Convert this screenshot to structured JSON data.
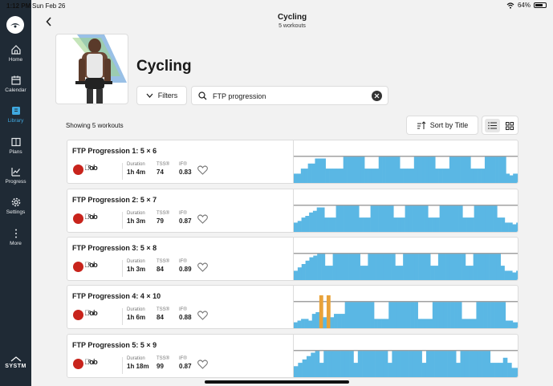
{
  "status": {
    "time": "1:12 PM",
    "date": "Sun Feb 26",
    "battery": "64%"
  },
  "nav": {
    "items": [
      {
        "label": "Home",
        "icon": "home-icon",
        "active": false
      },
      {
        "label": "Calendar",
        "icon": "calendar-icon",
        "active": false
      },
      {
        "label": "Library",
        "icon": "library-icon",
        "active": true
      },
      {
        "label": "Plans",
        "icon": "plans-icon",
        "active": false
      },
      {
        "label": "Progress",
        "icon": "progress-icon",
        "active": false
      },
      {
        "label": "Settings",
        "icon": "gear-icon",
        "active": false
      },
      {
        "label": "More",
        "icon": "more-icon",
        "active": false
      }
    ],
    "brand": "SYSTM"
  },
  "header": {
    "title": "Cycling",
    "subtitle": "5 workouts"
  },
  "page": {
    "title": "Cycling",
    "filters_label": "Filters",
    "search_value": "FTP progression",
    "showing": "Showing 5 workouts",
    "sort_label": "Sort by Title"
  },
  "workouts": [
    {
      "title": "FTP Progression 1: 5 × 6",
      "duration_label": "Duration",
      "duration": "1h 4m",
      "tss_label": "TSS®",
      "tss": "74",
      "if_label": "IF®",
      "if": "0.83",
      "profile": [
        0.3,
        0.3,
        0.45,
        0.45,
        0.6,
        0.6,
        0.75,
        0.75,
        0.75,
        0.45,
        0.45,
        0.45,
        0.45,
        0.45,
        0.8,
        0.8,
        0.8,
        0.8,
        0.8,
        0.8,
        0.45,
        0.45,
        0.45,
        0.45,
        0.8,
        0.8,
        0.8,
        0.8,
        0.8,
        0.8,
        0.45,
        0.45,
        0.45,
        0.45,
        0.8,
        0.8,
        0.8,
        0.8,
        0.8,
        0.8,
        0.45,
        0.45,
        0.45,
        0.45,
        0.8,
        0.8,
        0.8,
        0.8,
        0.8,
        0.8,
        0.45,
        0.45,
        0.45,
        0.45,
        0.8,
        0.8,
        0.8,
        0.8,
        0.8,
        0.8,
        0.3,
        0.25,
        0.3,
        0.3
      ]
    },
    {
      "title": "FTP Progression 2: 5 × 7",
      "duration_label": "Duration",
      "duration": "1h 3m",
      "tss_label": "TSS®",
      "tss": "79",
      "if_label": "IF®",
      "if": "0.87",
      "profile": [
        0.3,
        0.35,
        0.45,
        0.5,
        0.6,
        0.65,
        0.75,
        0.75,
        0.45,
        0.45,
        0.45,
        0.8,
        0.8,
        0.8,
        0.8,
        0.8,
        0.8,
        0.45,
        0.45,
        0.45,
        0.8,
        0.8,
        0.8,
        0.8,
        0.8,
        0.8,
        0.45,
        0.45,
        0.45,
        0.8,
        0.8,
        0.8,
        0.8,
        0.8,
        0.8,
        0.45,
        0.45,
        0.45,
        0.8,
        0.8,
        0.8,
        0.8,
        0.8,
        0.8,
        0.45,
        0.45,
        0.45,
        0.8,
        0.8,
        0.8,
        0.8,
        0.8,
        0.8,
        0.45,
        0.45,
        0.3,
        0.3,
        0.25,
        0.3
      ]
    },
    {
      "title": "FTP Progression 3: 5 × 8",
      "duration_label": "Duration",
      "duration": "1h 3m",
      "tss_label": "TSS®",
      "tss": "84",
      "if_label": "IF®",
      "if": "0.89",
      "profile": [
        0.3,
        0.4,
        0.5,
        0.6,
        0.7,
        0.75,
        0.8,
        0.8,
        0.45,
        0.45,
        0.8,
        0.8,
        0.8,
        0.8,
        0.8,
        0.8,
        0.8,
        0.45,
        0.45,
        0.8,
        0.8,
        0.8,
        0.8,
        0.8,
        0.8,
        0.8,
        0.45,
        0.45,
        0.8,
        0.8,
        0.8,
        0.8,
        0.8,
        0.8,
        0.8,
        0.45,
        0.45,
        0.8,
        0.8,
        0.8,
        0.8,
        0.8,
        0.8,
        0.8,
        0.45,
        0.45,
        0.8,
        0.8,
        0.8,
        0.8,
        0.8,
        0.8,
        0.8,
        0.45,
        0.3,
        0.3,
        0.25,
        0.3
      ]
    },
    {
      "title": "FTP Progression 4: 4 × 10",
      "duration_label": "Duration",
      "duration": "1h 6m",
      "tss_label": "TSS®",
      "tss": "84",
      "if_label": "IF®",
      "if": "0.88",
      "profile": [
        0.2,
        0.25,
        0.3,
        0.3,
        0.25,
        0.45,
        0.5,
        1.0,
        0.35,
        1.0,
        0.35,
        0.45,
        0.45,
        0.45,
        0.8,
        0.8,
        0.8,
        0.8,
        0.8,
        0.8,
        0.8,
        0.8,
        0.3,
        0.3,
        0.3,
        0.3,
        0.8,
        0.8,
        0.8,
        0.8,
        0.8,
        0.8,
        0.8,
        0.8,
        0.3,
        0.3,
        0.3,
        0.3,
        0.8,
        0.8,
        0.8,
        0.8,
        0.8,
        0.8,
        0.8,
        0.8,
        0.3,
        0.3,
        0.3,
        0.3,
        0.8,
        0.8,
        0.8,
        0.8,
        0.8,
        0.8,
        0.8,
        0.8,
        0.25,
        0.25,
        0.2,
        0.2
      ]
    },
    {
      "title": "FTP Progression 5: 5 × 9",
      "duration_label": "Duration",
      "duration": "1h 18m",
      "tss_label": "TSS®",
      "tss": "99",
      "if_label": "IF®",
      "if": "0.87",
      "profile": [
        0.35,
        0.45,
        0.55,
        0.65,
        0.75,
        0.8,
        0.45,
        0.8,
        0.8,
        0.8,
        0.8,
        0.8,
        0.8,
        0.8,
        0.45,
        0.8,
        0.8,
        0.8,
        0.8,
        0.8,
        0.8,
        0.8,
        0.45,
        0.8,
        0.8,
        0.8,
        0.8,
        0.8,
        0.8,
        0.8,
        0.45,
        0.8,
        0.8,
        0.8,
        0.8,
        0.8,
        0.8,
        0.8,
        0.45,
        0.8,
        0.8,
        0.8,
        0.8,
        0.8,
        0.8,
        0.8,
        0.45,
        0.45,
        0.45,
        0.6,
        0.45,
        0.3,
        0.3
      ]
    }
  ],
  "colors": {
    "sidebar": "#1f2a35",
    "accent": "#3fa9e0",
    "bar": "#5ab7e4",
    "badge": "#c8241c",
    "marker": "#e8a23a"
  }
}
